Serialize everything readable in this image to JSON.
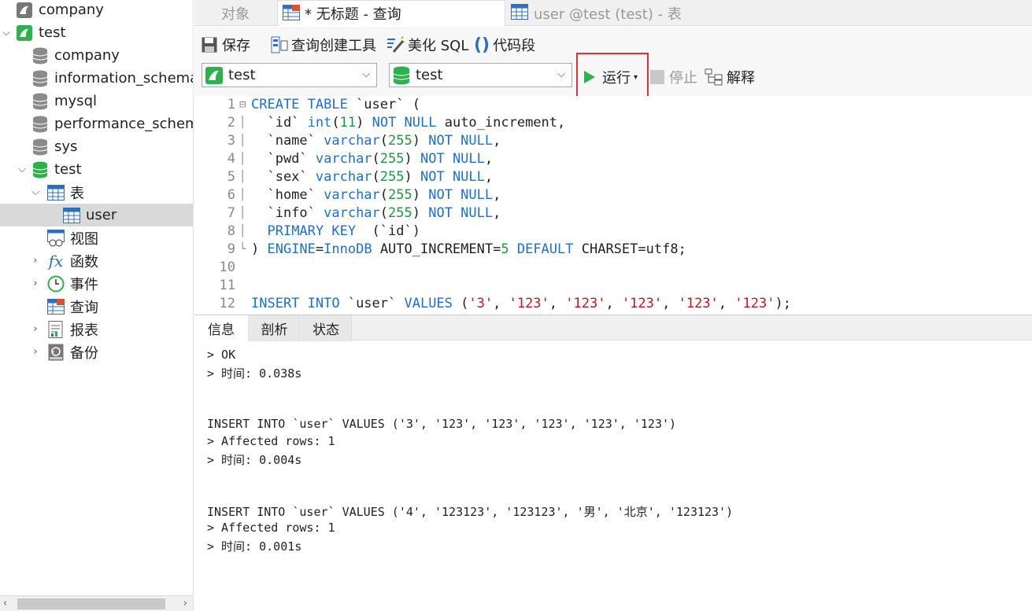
{
  "sidebar": {
    "connections": [
      {
        "label": "company"
      },
      {
        "label": "test"
      }
    ],
    "databases": [
      {
        "label": "company"
      },
      {
        "label": "information_schema"
      },
      {
        "label": "mysql"
      },
      {
        "label": "performance_schema"
      },
      {
        "label": "sys"
      },
      {
        "label": "test"
      }
    ],
    "groups": {
      "tables": "表",
      "table_user": "user",
      "views": "视图",
      "functions": "函数",
      "events": "事件",
      "queries": "查询",
      "reports": "报表",
      "backup": "备份"
    }
  },
  "tabs": [
    {
      "label": "对象"
    },
    {
      "label": "* 无标题 - 查询"
    },
    {
      "label": "user @test (test) - 表"
    }
  ],
  "toolbar": {
    "save": "保存",
    "query_builder": "查询创建工具",
    "beautify": "美化 SQL",
    "snippet": "代码段",
    "connection_select": "test",
    "database_select": "test",
    "run": "运行",
    "stop": "停止",
    "explain": "解释"
  },
  "editor": {
    "line_numbers": [
      "1",
      "2",
      "3",
      "4",
      "5",
      "6",
      "7",
      "8",
      "9",
      "10",
      "11",
      "12"
    ]
  },
  "bottom_tabs": [
    {
      "label": "信息"
    },
    {
      "label": "剖析"
    },
    {
      "label": "状态"
    }
  ],
  "output": [
    "> OK",
    "> 时间: 0.038s",
    "",
    "",
    "INSERT INTO `user` VALUES ('3', '123', '123', '123', '123', '123')",
    "> Affected rows: 1",
    "> 时间: 0.004s",
    "",
    "",
    "INSERT INTO `user` VALUES ('4', '123123', '123123', '男', '北京', '123123')",
    "> Affected rows: 1",
    "> 时间: 0.001s"
  ],
  "colors": {
    "keyword": "#1a6fd8",
    "number": "#1a9a3a",
    "string": "#d01020",
    "run_highlight": "#e03030"
  }
}
